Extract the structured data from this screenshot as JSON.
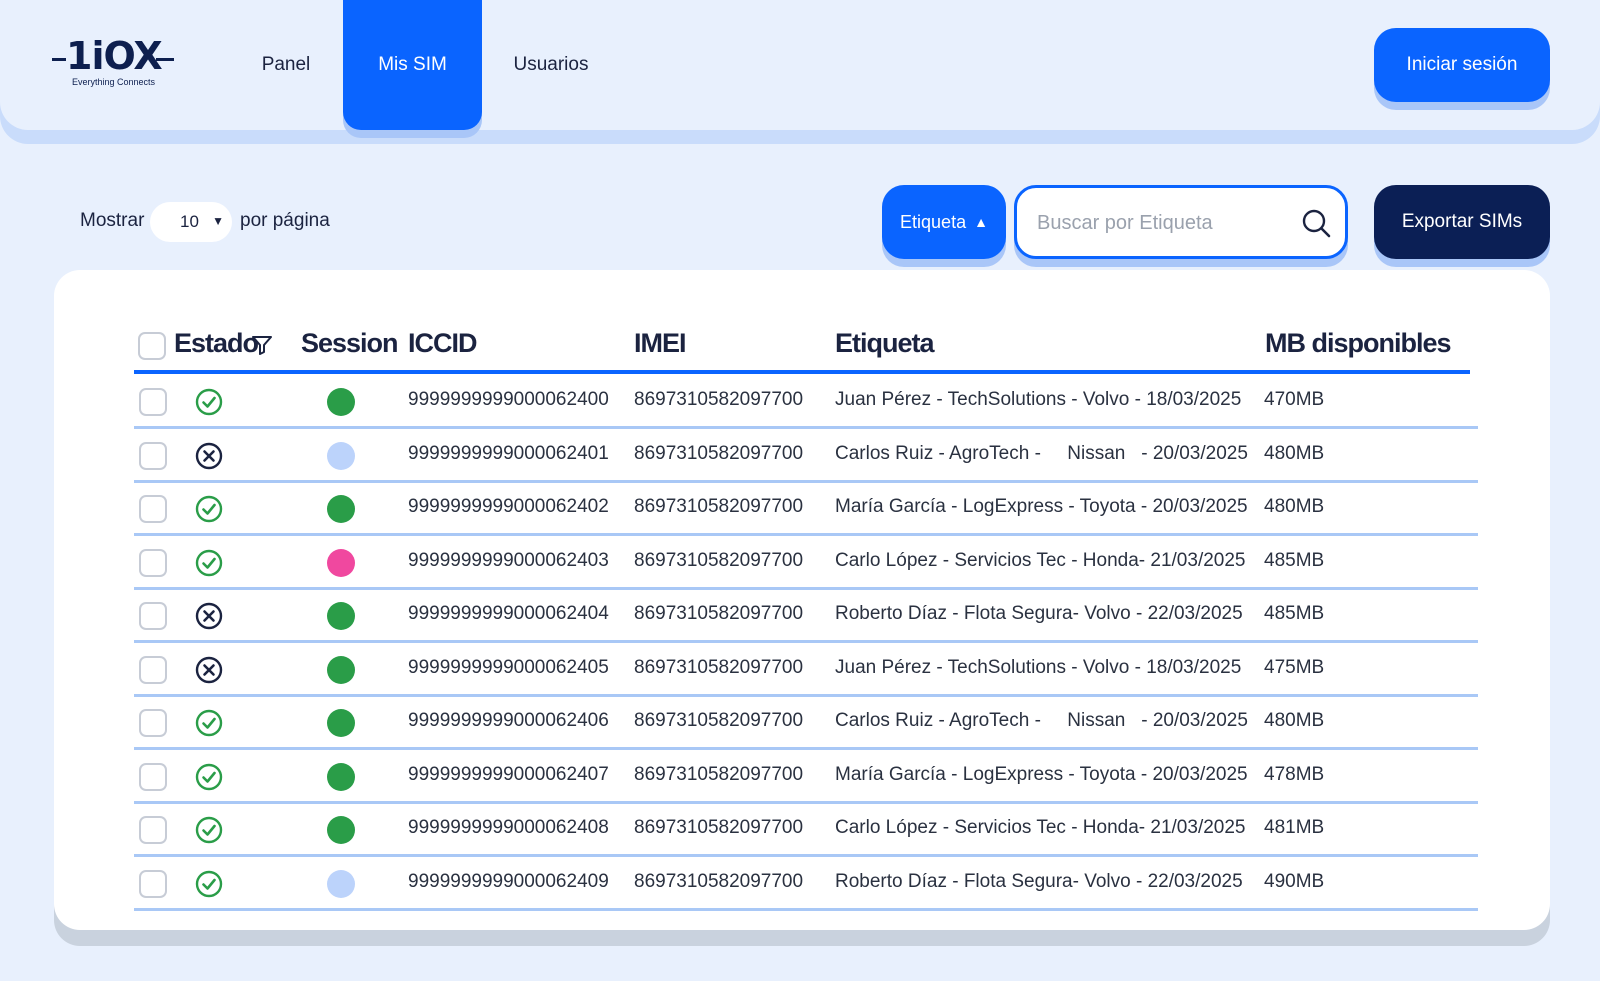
{
  "brand": {
    "name": "1iOX",
    "tagline": "Everything Connects"
  },
  "nav": {
    "items": [
      {
        "label": "Panel"
      },
      {
        "label": "Mis SIM"
      },
      {
        "label": "Usuarios"
      }
    ],
    "active": "Mis SIM",
    "login_label": "Iniciar sesión"
  },
  "toolbar": {
    "show_label": "Mostrar",
    "per_page_value": "10",
    "per_page_suffix": "por página",
    "tag_button_label": "Etiqueta",
    "tag_button_arrow": "▲",
    "search_placeholder": "Buscar por Etiqueta",
    "export_label": "Exportar SIMs"
  },
  "table": {
    "columns": [
      "Estado",
      "Session",
      "ICCID",
      "IMEI",
      "Etiqueta",
      "MB disponibles"
    ],
    "rows": [
      {
        "estado": "active",
        "session": "green",
        "iccid": "9999999999000062400",
        "imei": "8697310582097700",
        "etiqueta": "Juan Pérez - TechSolutions - Volvo - 18/03/2025",
        "mb": "470MB"
      },
      {
        "estado": "inactive",
        "session": "light",
        "iccid": "9999999999000062401",
        "imei": "8697310582097700",
        "etiqueta": "Carlos Ruiz - AgroTech -     Nissan   - 20/03/2025",
        "mb": "480MB"
      },
      {
        "estado": "active",
        "session": "green",
        "iccid": "9999999999000062402",
        "imei": "8697310582097700",
        "etiqueta": "María García - LogExpress - Toyota - 20/03/2025",
        "mb": "480MB"
      },
      {
        "estado": "active",
        "session": "pink",
        "iccid": "9999999999000062403",
        "imei": "8697310582097700",
        "etiqueta": "Carlo López - Servicios Tec - Honda- 21/03/2025",
        "mb": "485MB"
      },
      {
        "estado": "inactive",
        "session": "green",
        "iccid": "9999999999000062404",
        "imei": "8697310582097700",
        "etiqueta": "Roberto Díaz - Flota Segura- Volvo - 22/03/2025",
        "mb": "485MB"
      },
      {
        "estado": "inactive",
        "session": "green",
        "iccid": "9999999999000062405",
        "imei": "8697310582097700",
        "etiqueta": "Juan Pérez - TechSolutions - Volvo - 18/03/2025",
        "mb": "475MB"
      },
      {
        "estado": "active",
        "session": "green",
        "iccid": "9999999999000062406",
        "imei": "8697310582097700",
        "etiqueta": "Carlos Ruiz - AgroTech -     Nissan   - 20/03/2025",
        "mb": "480MB"
      },
      {
        "estado": "active",
        "session": "green",
        "iccid": "9999999999000062407",
        "imei": "8697310582097700",
        "etiqueta": "María García - LogExpress - Toyota - 20/03/2025",
        "mb": "478MB"
      },
      {
        "estado": "active",
        "session": "green",
        "iccid": "9999999999000062408",
        "imei": "8697310582097700",
        "etiqueta": "Carlo López - Servicios Tec - Honda- 21/03/2025",
        "mb": "481MB"
      },
      {
        "estado": "active",
        "session": "light",
        "iccid": "9999999999000062409",
        "imei": "8697310582097700",
        "etiqueta": "Roberto Díaz - Flota Segura- Volvo - 22/03/2025",
        "mb": "490MB"
      }
    ]
  },
  "colors": {
    "primary": "#0a64ff",
    "dark": "#0b1f55",
    "background": "#e8f0fd",
    "status_active": "#2a9d48",
    "status_inactive": "#1b2340",
    "session_green": "#2a9d48",
    "session_light": "#bcd3fb",
    "session_pink": "#f0489f",
    "row_divider": "#a9c8f6"
  }
}
